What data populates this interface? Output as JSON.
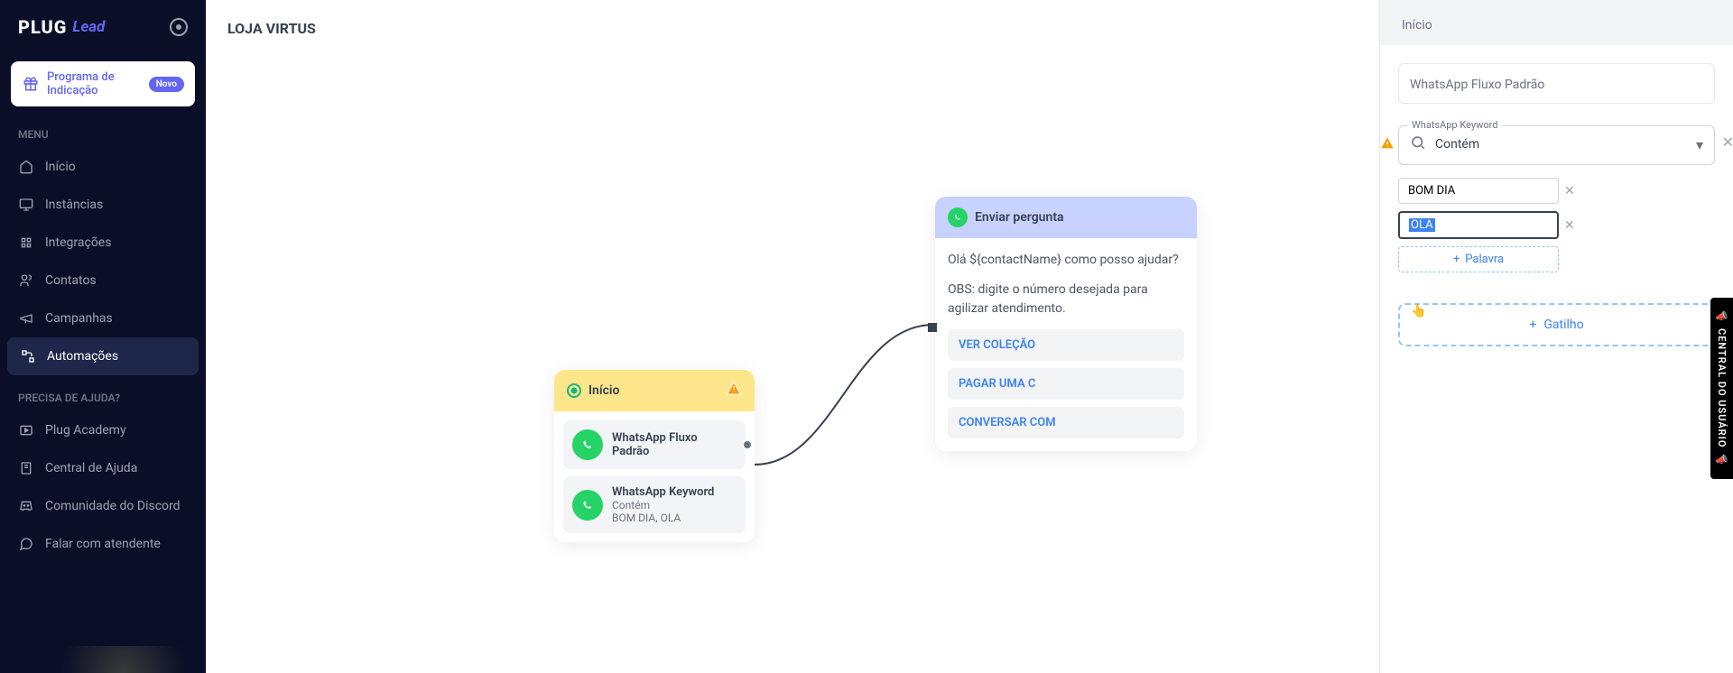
{
  "sidebar": {
    "logo": {
      "part1": "PLUG",
      "part2": "Lead"
    },
    "promo": {
      "text": "Programa de Indicação",
      "badge": "Novo"
    },
    "menuLabel": "MENU",
    "menu": [
      {
        "label": "Início",
        "icon": "home"
      },
      {
        "label": "Instâncias",
        "icon": "monitor"
      },
      {
        "label": "Integrações",
        "icon": "puzzle"
      },
      {
        "label": "Contatos",
        "icon": "users"
      },
      {
        "label": "Campanhas",
        "icon": "megaphone"
      },
      {
        "label": "Automações",
        "icon": "workflow"
      }
    ],
    "helpLabel": "PRECISA DE AJUDA?",
    "help": [
      {
        "label": "Plug Academy",
        "icon": "play"
      },
      {
        "label": "Central de Ajuda",
        "icon": "book"
      },
      {
        "label": "Comunidade do Discord",
        "icon": "discord"
      },
      {
        "label": "Falar com atendente",
        "icon": "chat"
      }
    ]
  },
  "header": {
    "title": "LOJA VIRTUS"
  },
  "canvas": {
    "startNode": {
      "title": "Início",
      "items": [
        {
          "title": "WhatsApp Fluxo Padrão",
          "sub": ""
        },
        {
          "title": "WhatsApp Keyword",
          "sub1": "Contém",
          "sub2": "BOM DIA, OLA"
        }
      ]
    },
    "questionNode": {
      "title": "Enviar pergunta",
      "text1": "Olá ${contactName} como posso ajudar?",
      "text2": "OBS: digite o número desejada para agilizar atendimento.",
      "options": [
        "VER COLEÇÃO",
        "PAGAR UMA C",
        "CONVERSAR COM"
      ]
    }
  },
  "panel": {
    "header": "Início",
    "flowName": "WhatsApp Fluxo Padrão",
    "keyword": {
      "label": "WhatsApp Keyword",
      "mode": "Contém",
      "tags": [
        "BOM DIA",
        "OLA"
      ],
      "addWord": "Palavra"
    },
    "addTrigger": "Gatilho"
  },
  "sideTab": "CENTRAL DO USUÁRIO"
}
